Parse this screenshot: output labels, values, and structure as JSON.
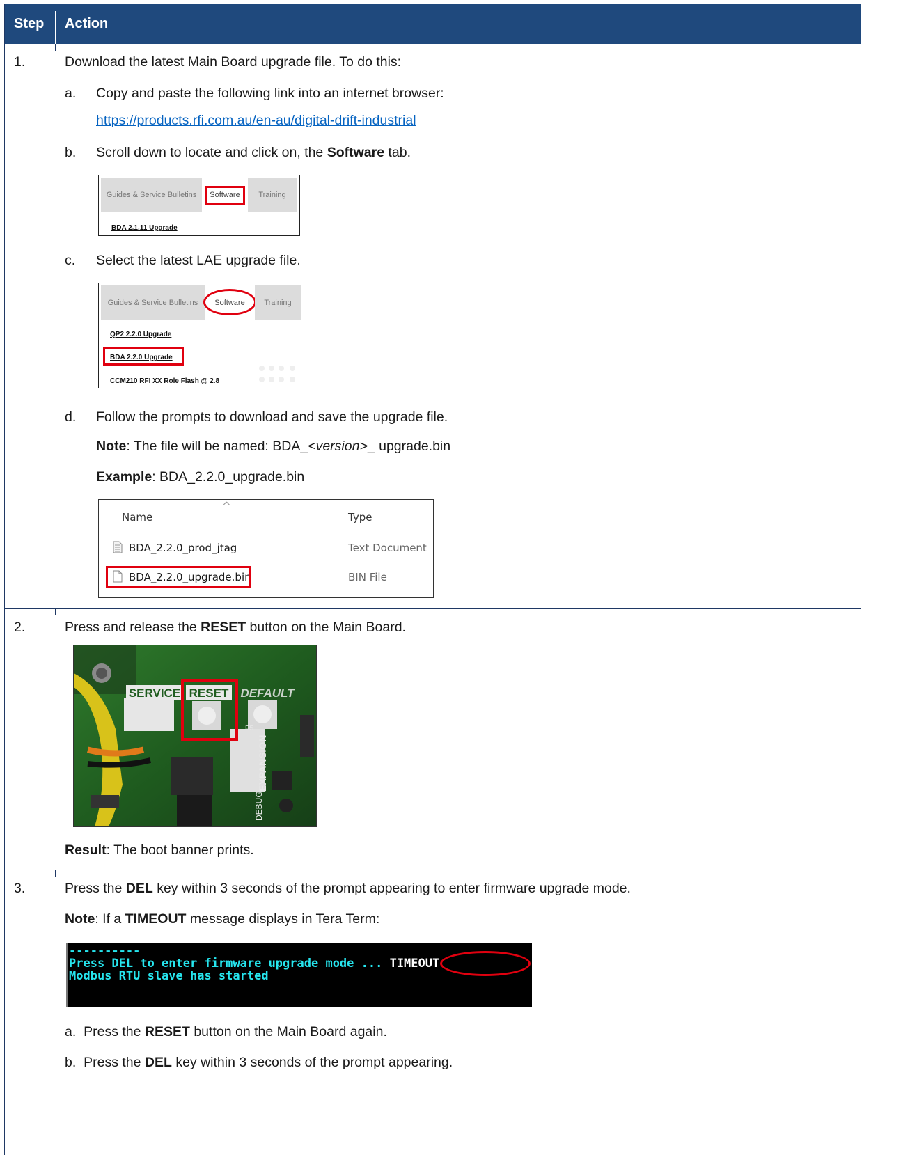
{
  "header": {
    "step": "Step",
    "action": "Action"
  },
  "step1": {
    "num": "1.",
    "title": "Download the latest Main Board upgrade file. To do this:",
    "a_marker": "a.",
    "a_text": "Copy and paste the following link into an internet browser:",
    "link": "https://products.rfi.com.au/en-au/digital-drift-industrial",
    "b_marker": "b.",
    "b_pre": "Scroll down to locate and click on, the ",
    "b_bold": "Software",
    "b_post": " tab.",
    "shot_b": {
      "tab_guides": "Guides & Service Bulletins",
      "tab_software": "Software",
      "tab_training": "Training",
      "item": "BDA 2.1.11 Upgrade"
    },
    "c_marker": "c.",
    "c_text": "Select the latest LAE upgrade file.",
    "shot_c": {
      "tab_guides": "Guides & Service Bulletins",
      "tab_software": "Software",
      "tab_training": "Training",
      "item1": "QP2 2.2.0 Upgrade",
      "item2": "BDA 2.2.0 Upgrade",
      "item3": "CCM210 RFI XX Role Flash @ 2.8"
    },
    "d_marker": "d.",
    "d_text": "Follow the prompts to download and save the upgrade file.",
    "note_label": "Note",
    "note_pre": ": The file will be named: BDA_",
    "note_italic": "<version>",
    "note_post": "_ upgrade.bin",
    "example_label": "Example",
    "example_text": ": BDA_2.2.0_upgrade.bin",
    "explorer": {
      "col_name": "Name",
      "col_type": "Type",
      "sort_glyph": "^",
      "file1": "BDA_2.2.0_prod_jtag",
      "file1_type": "Text Document",
      "file2": "BDA_2.2.0_upgrade.bin",
      "file2_type": "BIN File"
    }
  },
  "step2": {
    "num": "2.",
    "pre": "Press and release the ",
    "bold": "RESET",
    "post": " button on the Main Board.",
    "photo": {
      "label_service": "SERVICE",
      "label_reset": "RESET",
      "label_default": "DEFAULT",
      "silk_expansion": "EXPANSION",
      "silk_debug": "DEBUG",
      "silk_p5": "P5"
    },
    "result_label": "Result",
    "result_text": ": The boot banner prints."
  },
  "step3": {
    "num": "3.",
    "pre": "Press the ",
    "bold": "DEL",
    "post": " key within 3 seconds of the prompt appearing to enter firmware upgrade mode.",
    "note_label": "Note",
    "note_pre": ": If a ",
    "note_bold": "TIMEOUT",
    "note_post": " message displays in Tera Term:",
    "terminal": {
      "line1": "----------",
      "line2_pre": "Press DEL to enter firmware upgrade mode ... ",
      "line2_timeout": "TIMEOUT",
      "line3": "Modbus RTU slave has started"
    },
    "a_marker": "a.",
    "a_pre": "Press the ",
    "a_bold": "RESET",
    "a_post": " button on the Main Board again.",
    "b_marker": "b.",
    "b_pre": "Press the ",
    "b_bold": "DEL",
    "b_post": " key within 3 seconds of the prompt appearing."
  }
}
